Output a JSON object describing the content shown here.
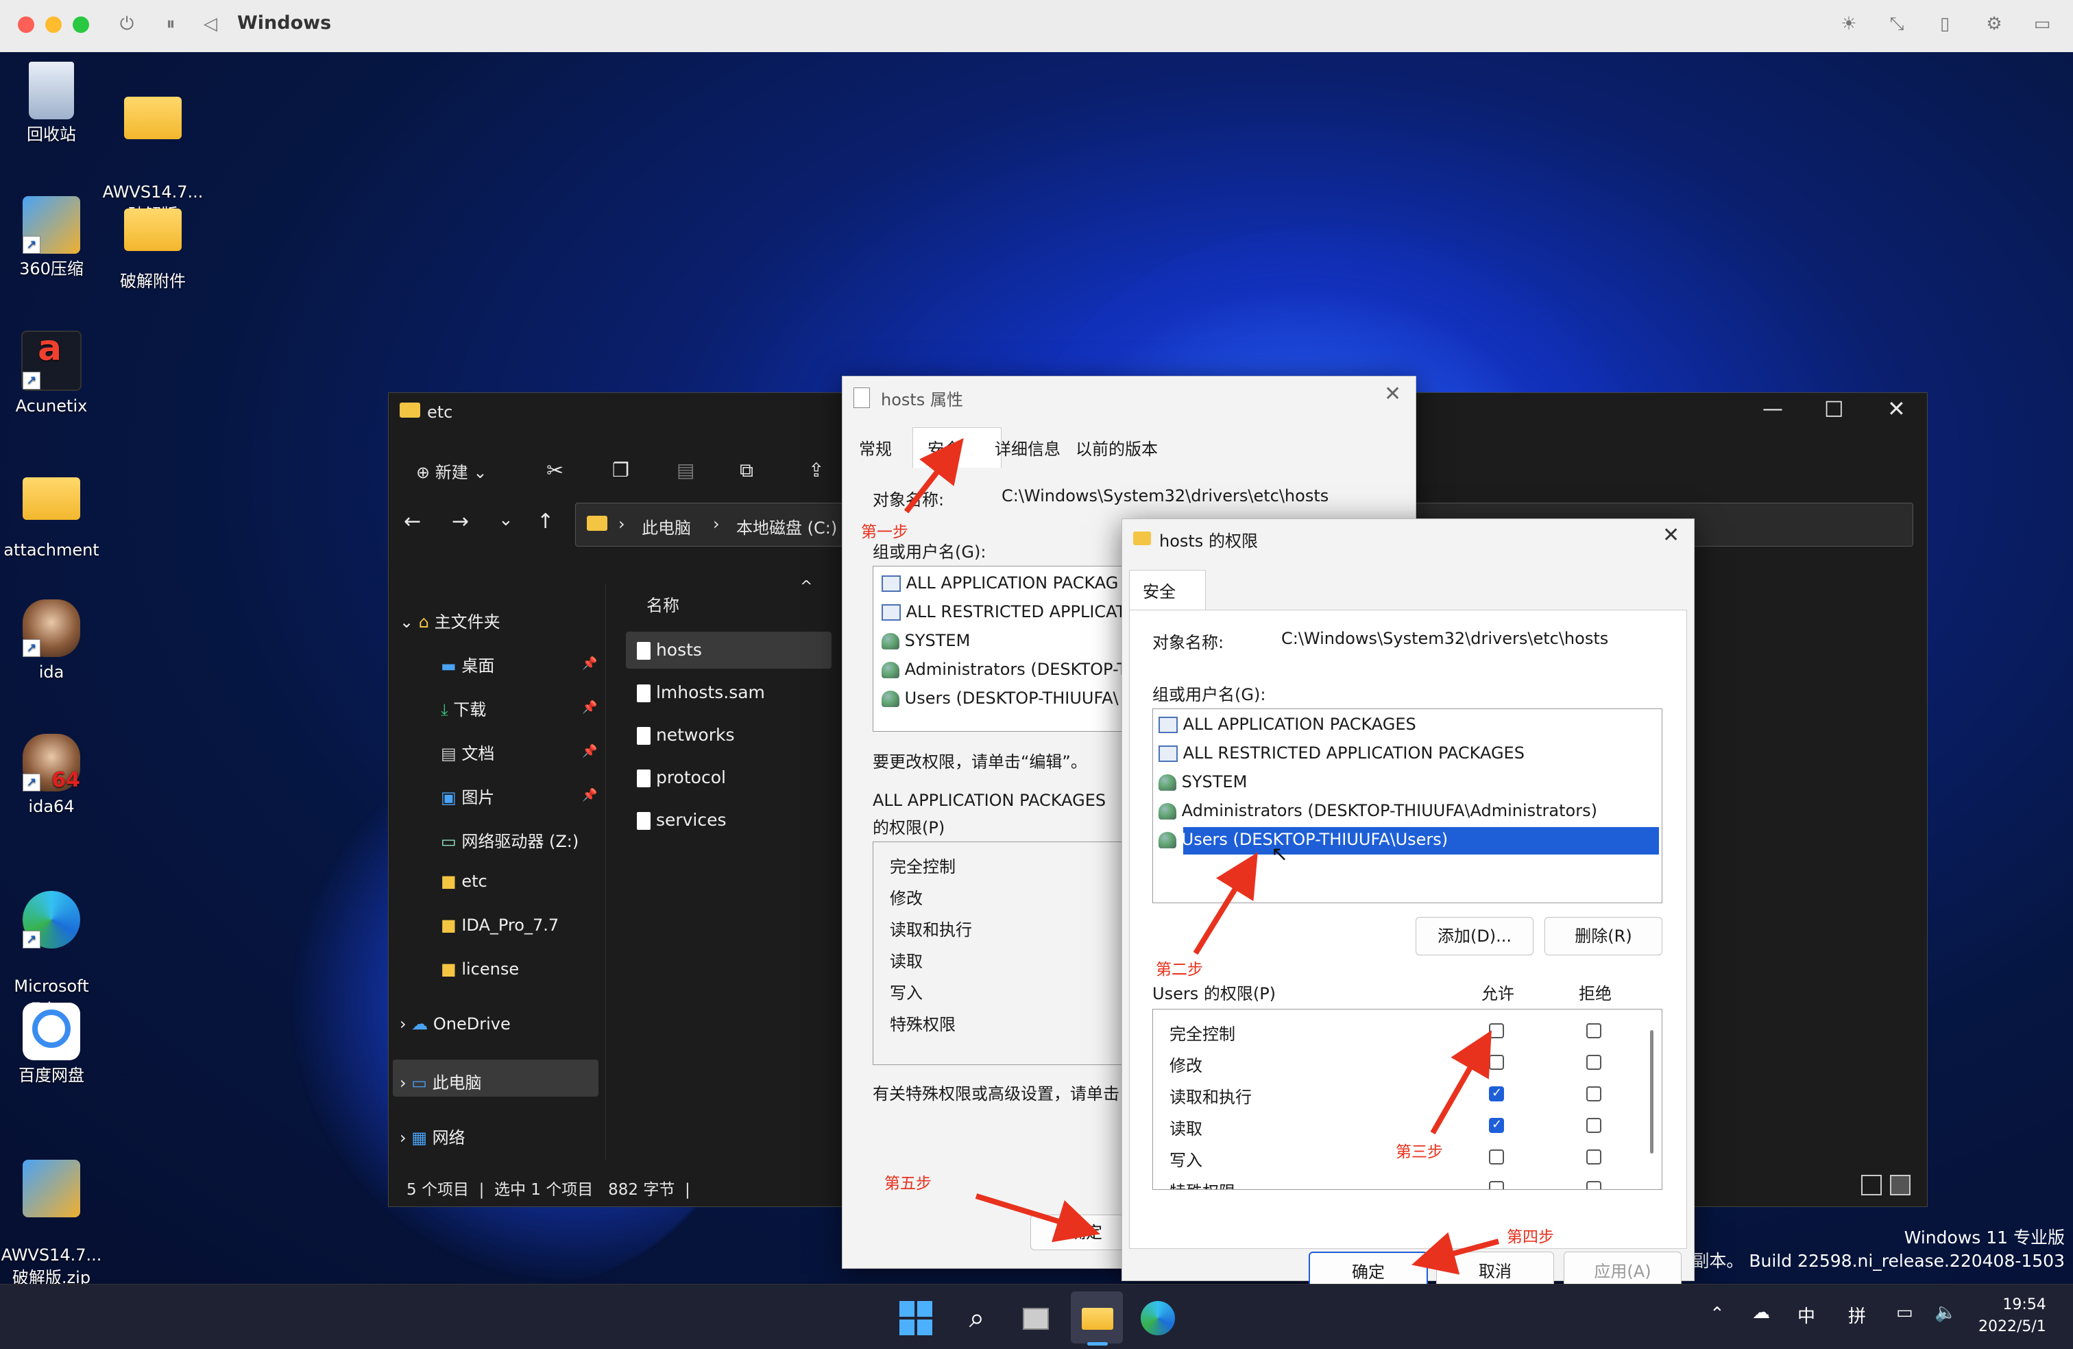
{
  "host": {
    "title": "Windows"
  },
  "desktop_icons": [
    {
      "label": "回收站",
      "icon": "recycle-bin-icon"
    },
    {
      "label": "AWVS14.7...\n破解版",
      "icon": "folder-icon"
    },
    {
      "label": "360压缩",
      "icon": "zip-app-icon"
    },
    {
      "label": "破解附件",
      "icon": "folder-icon"
    },
    {
      "label": "Acunetix",
      "icon": "acunetix-icon"
    },
    {
      "label": "attachment",
      "icon": "folder-icon"
    },
    {
      "label": "ida",
      "icon": "ida-icon"
    },
    {
      "label": "ida64",
      "icon": "ida64-icon"
    },
    {
      "label": "Microsoft\nEdge",
      "icon": "edge-icon"
    },
    {
      "label": "百度网盘",
      "icon": "baidu-netdisk-icon"
    },
    {
      "label": "AWVS14.7...\n破解版.zip",
      "icon": "zip-file-icon"
    }
  ],
  "explorer": {
    "title": "etc",
    "new_label": "新建",
    "breadcrumb": [
      "此电脑",
      "本地磁盘 (C:)"
    ],
    "nav": {
      "home": "主文件夹",
      "quick": [
        {
          "label": "桌面",
          "pinned": true
        },
        {
          "label": "下载",
          "pinned": true
        },
        {
          "label": "文档",
          "pinned": true
        },
        {
          "label": "图片",
          "pinned": true
        },
        {
          "label": "网络驱动器 (Z:)",
          "pinned": false
        },
        {
          "label": "etc",
          "pinned": false
        },
        {
          "label": "IDA_Pro_7.7",
          "pinned": false
        },
        {
          "label": "license",
          "pinned": false
        }
      ],
      "onedrive": "OneDrive",
      "thispc": "此电脑",
      "network": "网络"
    },
    "column_name": "名称",
    "files": [
      "hosts",
      "lmhosts.sam",
      "networks",
      "protocol",
      "services"
    ],
    "status": {
      "count": "5 个项目",
      "selected": "选中 1 个项目",
      "size": "882 字节"
    }
  },
  "props_dialog": {
    "title": "hosts 属性",
    "tabs": [
      "常规",
      "安全",
      "详细信息",
      "以前的版本"
    ],
    "object_label": "对象名称:",
    "object_path": "C:\\Windows\\System32\\drivers\\etc\\hosts",
    "group_label": "组或用户名(G):",
    "groups": [
      "ALL APPLICATION PACKAG",
      "ALL RESTRICTED APPLICAT",
      "SYSTEM",
      "Administrators (DESKTOP-T",
      "Users (DESKTOP-THIUUFA\\"
    ],
    "edit_hint": "要更改权限，请单击“编辑”。",
    "perm_label_1": "ALL APPLICATION PACKAGES",
    "perm_label_2": "的权限(P)",
    "perms": [
      "完全控制",
      "修改",
      "读取和执行",
      "读取",
      "写入",
      "特殊权限"
    ],
    "special_hint": "有关特殊权限或高级设置，请单击",
    "ok": "确定"
  },
  "perm_dialog": {
    "title": "hosts 的权限",
    "tab": "安全",
    "object_label": "对象名称:",
    "object_path": "C:\\Windows\\System32\\drivers\\etc\\hosts",
    "group_label": "组或用户名(G):",
    "groups": [
      "ALL APPLICATION PACKAGES",
      "ALL RESTRICTED APPLICATION PACKAGES",
      "SYSTEM",
      "Administrators (DESKTOP-THIUUFA\\Administrators)",
      "Users (DESKTOP-THIUUFA\\Users)"
    ],
    "selected_group": 4,
    "add": "添加(D)...",
    "remove": "删除(R)",
    "perm_label": "Users 的权限(P)",
    "allow": "允许",
    "deny": "拒绝",
    "perms": [
      {
        "name": "完全控制",
        "allow": false,
        "deny": false
      },
      {
        "name": "修改",
        "allow": false,
        "deny": false
      },
      {
        "name": "读取和执行",
        "allow": true,
        "deny": false
      },
      {
        "name": "读取",
        "allow": true,
        "deny": false
      },
      {
        "name": "写入",
        "allow": false,
        "deny": false
      },
      {
        "name": "特殊权限",
        "allow": false,
        "deny": false
      }
    ],
    "ok": "确定",
    "cancel": "取消",
    "apply": "应用(A)"
  },
  "annotations": [
    "第一步",
    "第二步",
    "第三步",
    "第四步",
    "第五步"
  ],
  "watermark": {
    "line1": "Windows 11 专业版",
    "line2": "评估副本。 Build 22598.ni_release.220408-1503"
  },
  "tray": {
    "ime1": "中",
    "ime2": "拼",
    "time": "19:54",
    "date": "2022/5/1"
  },
  "colors": {
    "accent": "#1e5fd8",
    "annotation_red": "#e8321e"
  }
}
